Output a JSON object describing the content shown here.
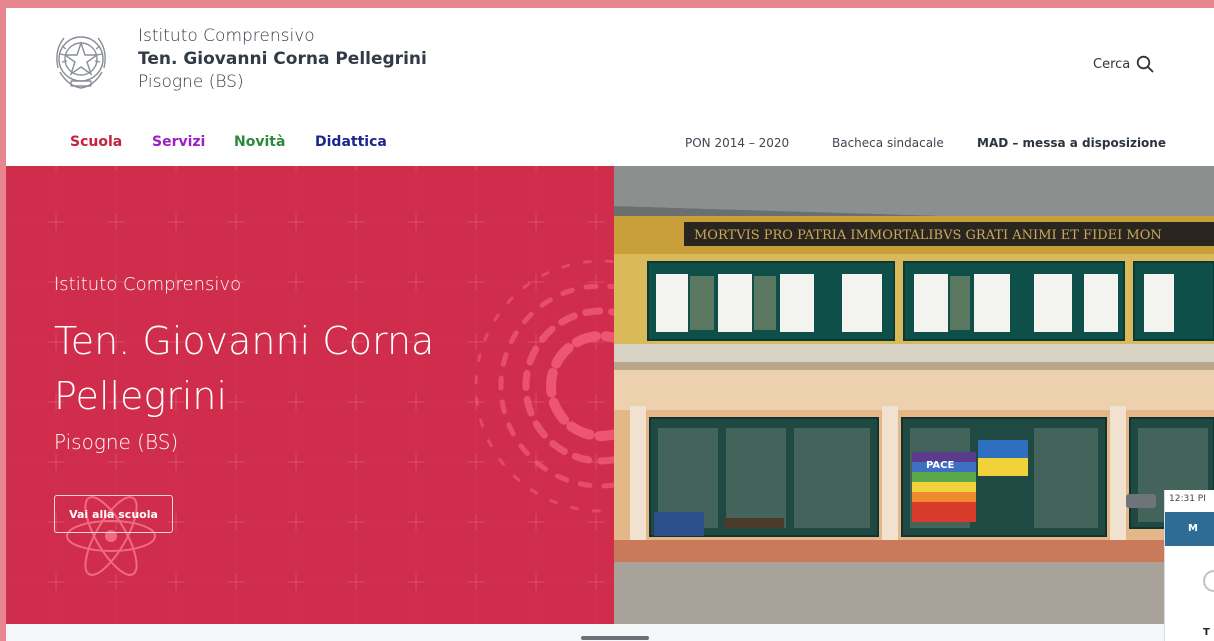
{
  "header": {
    "logo_name": "emblem-of-italy",
    "school_line1": "Istituto Comprensivo",
    "school_line2": "Ten. Giovanni Corna Pellegrini",
    "school_line3": "Pisogne (BS)",
    "search_label": "Cerca",
    "search_icon": "magnifier"
  },
  "nav": {
    "primary": [
      "Scuola",
      "Servizi",
      "Novità",
      "Didattica"
    ],
    "secondary": [
      "PON 2014 – 2020",
      "Bacheca sindacale",
      "MAD – messa a disposizione"
    ]
  },
  "hero": {
    "subtitle": "Istituto Comprensivo",
    "title": "Ten. Giovanni Corna Pellegrini",
    "location": "Pisogne (BS)",
    "button_label": "Vai alla scuola",
    "background_color": "#cf2d4b"
  },
  "photo": {
    "inscription": "MORTVIS PRO PATRIA IMMORTALIBVS GRATI ANIMI ET FIDEI MON",
    "flag_text": "PACE"
  },
  "overlay": {
    "time": "12:31 PI",
    "bar_label": "M",
    "initial": "T"
  },
  "colors": {
    "frame": "#e7868e",
    "scuola": "#c7213d",
    "servizi": "#9e1fc3",
    "novita": "#2a8a3a",
    "didattica": "#1b258e"
  }
}
